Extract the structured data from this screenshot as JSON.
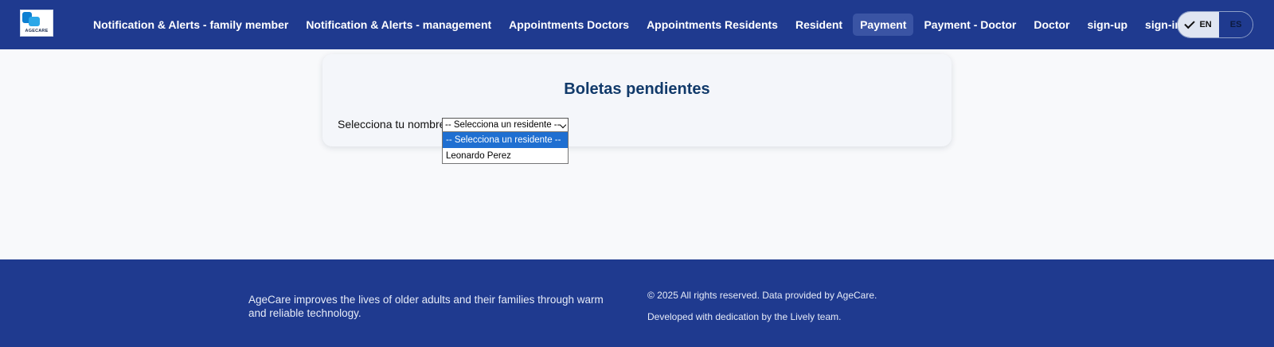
{
  "header": {
    "logo_text": "AGECARE",
    "nav": [
      {
        "label": "Notification & Alerts - family member"
      },
      {
        "label": "Notification & Alerts - management"
      },
      {
        "label": "Appointments Doctors"
      },
      {
        "label": "Appointments Residents"
      },
      {
        "label": "Resident"
      },
      {
        "label": "Payment",
        "active": true
      },
      {
        "label": "Payment - Doctor"
      },
      {
        "label": "Doctor"
      },
      {
        "label": "sign-up"
      },
      {
        "label": "sign-in"
      }
    ],
    "language": {
      "en": "EN",
      "es": "ES",
      "selected": "EN"
    }
  },
  "main": {
    "title": "Boletas pendientes",
    "select_label": "Selecciona tu nombre:",
    "select_value": "-- Selecciona un residente --",
    "options": [
      {
        "label": "-- Selecciona un residente --",
        "highlighted": true
      },
      {
        "label": "Leonardo Perez"
      }
    ]
  },
  "footer": {
    "about": "AgeCare improves the lives of older adults and their families through warm and reliable technology.",
    "rights": "© 2025 All rights reserved. Data provided by AgeCare.",
    "team": "Developed with dedication by the Lively team."
  },
  "colors": {
    "header_bg": "#1f3a8f",
    "active_nav_bg": "#3a54a4",
    "title": "#113a6a",
    "option_highlight": "#1f6fd1"
  }
}
